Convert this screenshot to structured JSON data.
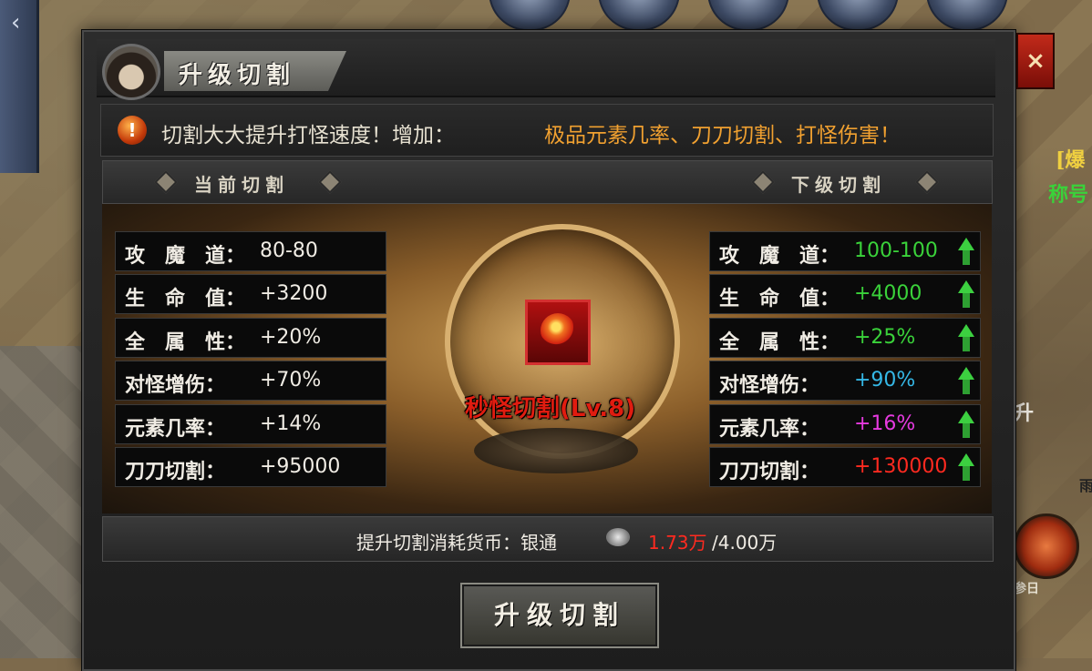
{
  "window": {
    "title": "升级切割",
    "close_label": "×"
  },
  "notice": {
    "icon_symbol": "!",
    "text_prefix": "切割大大提升打怪速度！增加：",
    "text_highlight": "极品元素几率、刀刀切割、打怪伤害！"
  },
  "current": {
    "header": "当前切割",
    "stats": [
      {
        "label": "攻　魔　道：",
        "value": "80-80"
      },
      {
        "label": "生　命　值：",
        "value": "+3200"
      },
      {
        "label": "全　属　性：",
        "value": "+20%"
      },
      {
        "label": "对怪增伤：",
        "value": "+70%"
      },
      {
        "label": "元素几率：",
        "value": "+14%"
      },
      {
        "label": "刀刀切割：",
        "value": "+95000"
      }
    ]
  },
  "next": {
    "header": "下级切割",
    "stats": [
      {
        "label": "攻　魔　道：",
        "value": "100-100",
        "color": "#3ad23a"
      },
      {
        "label": "生　命　值：",
        "value": "+4000",
        "color": "#3ad23a"
      },
      {
        "label": "全　属　性：",
        "value": "+25%",
        "color": "#3ad23a"
      },
      {
        "label": "对怪增伤：",
        "value": "+90%",
        "color": "#35b8e6"
      },
      {
        "label": "元素几率：",
        "value": "+16%",
        "color": "#e63ae0"
      },
      {
        "label": "刀刀切割：",
        "value": "+130000",
        "color": "#ff2a20"
      }
    ]
  },
  "item": {
    "name": "秒怪切割(Lv.8)"
  },
  "cost": {
    "label": "提升切割消耗货币：银通",
    "current": "1.73万",
    "total": "/4.00万",
    "current_color": "#ff2a20"
  },
  "upgrade_button": "升级切割",
  "hud": {
    "right_text_1": "[爆",
    "right_text_2": "称号",
    "right_text_3": "升",
    "right_text_4": "雨",
    "right_text_5": "参日"
  },
  "colors": {
    "accent_red": "#e01c10",
    "notice_highlight": "#f0a030"
  }
}
